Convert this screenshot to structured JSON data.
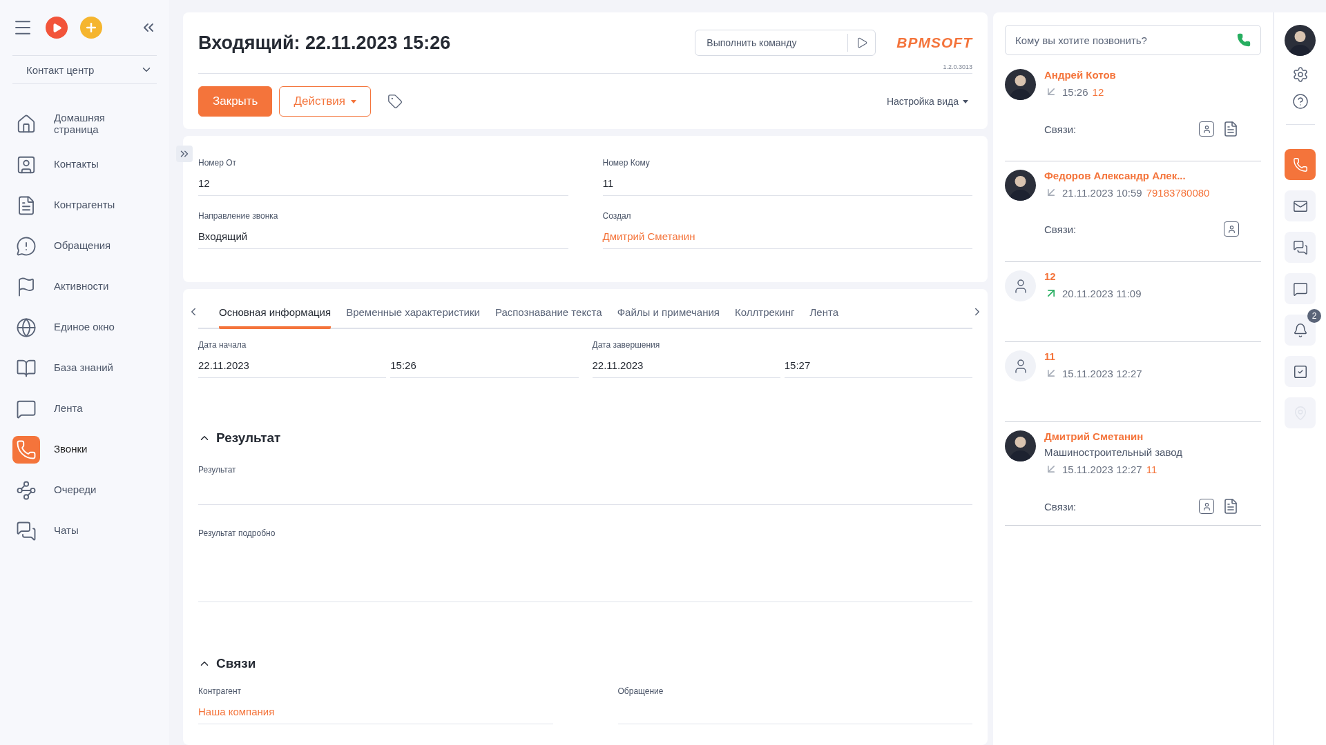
{
  "sidebar": {
    "section_select": "Контакт центр",
    "items": [
      {
        "label": "Домашняя страница",
        "selected": false
      },
      {
        "label": "Контакты",
        "selected": false
      },
      {
        "label": "Контрагенты",
        "selected": false
      },
      {
        "label": "Обращения",
        "selected": false
      },
      {
        "label": "Активности",
        "selected": false
      },
      {
        "label": "Единое окно",
        "selected": false
      },
      {
        "label": "База знаний",
        "selected": false
      },
      {
        "label": "Лента",
        "selected": false
      },
      {
        "label": "Звонки",
        "selected": true
      },
      {
        "label": "Очереди",
        "selected": false
      },
      {
        "label": "Чаты",
        "selected": false
      }
    ]
  },
  "header": {
    "title": "Входящий: 22.11.2023 15:26",
    "command": {
      "placeholder": "Выполнить команду"
    },
    "logo": "BPMSOFT",
    "version": "1.2.0.3013",
    "buttons": [
      {
        "label": "Закрыть",
        "kind": "primary"
      },
      {
        "label": "Действия",
        "kind": "dropdown"
      }
    ],
    "view_settings": "Настройка вида"
  },
  "fields": [
    {
      "label": "Номер От",
      "value": "12",
      "kind": "text"
    },
    {
      "label": "Номер Кому",
      "value": "11",
      "kind": "text"
    },
    {
      "label": "Направление звонка",
      "value": "Входящий",
      "kind": "text"
    },
    {
      "label": "Создал",
      "value": "Дмитрий Сметанин",
      "kind": "link"
    }
  ],
  "tabs": [
    {
      "label": "Основная информация",
      "selected": true
    },
    {
      "label": "Временные характеристики",
      "selected": false
    },
    {
      "label": "Распознавание текста",
      "selected": false
    },
    {
      "label": "Файлы и примечания",
      "selected": false
    },
    {
      "label": "Коллтрекинг",
      "selected": false
    },
    {
      "label": "Лента",
      "selected": false
    }
  ],
  "dates": [
    {
      "label": "Дата начала",
      "date": "22.11.2023",
      "time": "15:26"
    },
    {
      "label": "Дата завершения",
      "date": "22.11.2023",
      "time": "15:27"
    }
  ],
  "sections": [
    {
      "title": "Результат",
      "expanded": true,
      "columns": false,
      "fields": [
        {
          "label": "Результат",
          "kind": "text"
        },
        {
          "label": "Результат подробно",
          "kind": "multiline"
        }
      ]
    },
    {
      "title": "Связи",
      "expanded": true,
      "columns": true,
      "fields": [
        {
          "label": "Контрагент",
          "value": "Наша компания",
          "kind": "link"
        },
        {
          "label": "Обращение"
        }
      ]
    }
  ],
  "calls": {
    "search": {
      "placeholder": "Кому вы хотите позвонить?"
    },
    "items": [
      {
        "name": "Андрей Котов",
        "photo": true,
        "outgoing": false,
        "time": "15:26",
        "number": "12",
        "links_label": "Связи:",
        "links": [
          {
            "kind": "contact"
          },
          {
            "kind": "document"
          }
        ]
      },
      {
        "name": "Федоров Александр Алек...",
        "photo": true,
        "outgoing": false,
        "time": "21.11.2023 10:59",
        "number": "79183780080",
        "links_label": "Связи:",
        "links": [
          {
            "kind": "contact"
          }
        ]
      },
      {
        "name": "12",
        "photo": false,
        "outgoing": true,
        "time": "20.11.2023 11:09"
      },
      {
        "name": "11",
        "photo": false,
        "outgoing": false,
        "time": "15.11.2023 12:27"
      },
      {
        "name": "Дмитрий Сметанин",
        "subtitle": "Машиностроительный завод",
        "photo": true,
        "outgoing": false,
        "time": "15.11.2023 12:27",
        "number": "11",
        "links_label": "Связи:",
        "links": [
          {
            "kind": "contact"
          },
          {
            "kind": "document"
          }
        ]
      }
    ]
  },
  "rail": [
    {
      "kind": "phone",
      "selected": true,
      "disabled": false
    },
    {
      "kind": "mail",
      "selected": false,
      "disabled": false
    },
    {
      "kind": "chats",
      "selected": false,
      "disabled": false
    },
    {
      "kind": "message",
      "selected": false,
      "disabled": false
    },
    {
      "kind": "bell",
      "selected": false,
      "disabled": false,
      "badge": "2"
    },
    {
      "kind": "task",
      "selected": false,
      "disabled": false
    },
    {
      "kind": "pin",
      "selected": false,
      "disabled": true
    }
  ]
}
